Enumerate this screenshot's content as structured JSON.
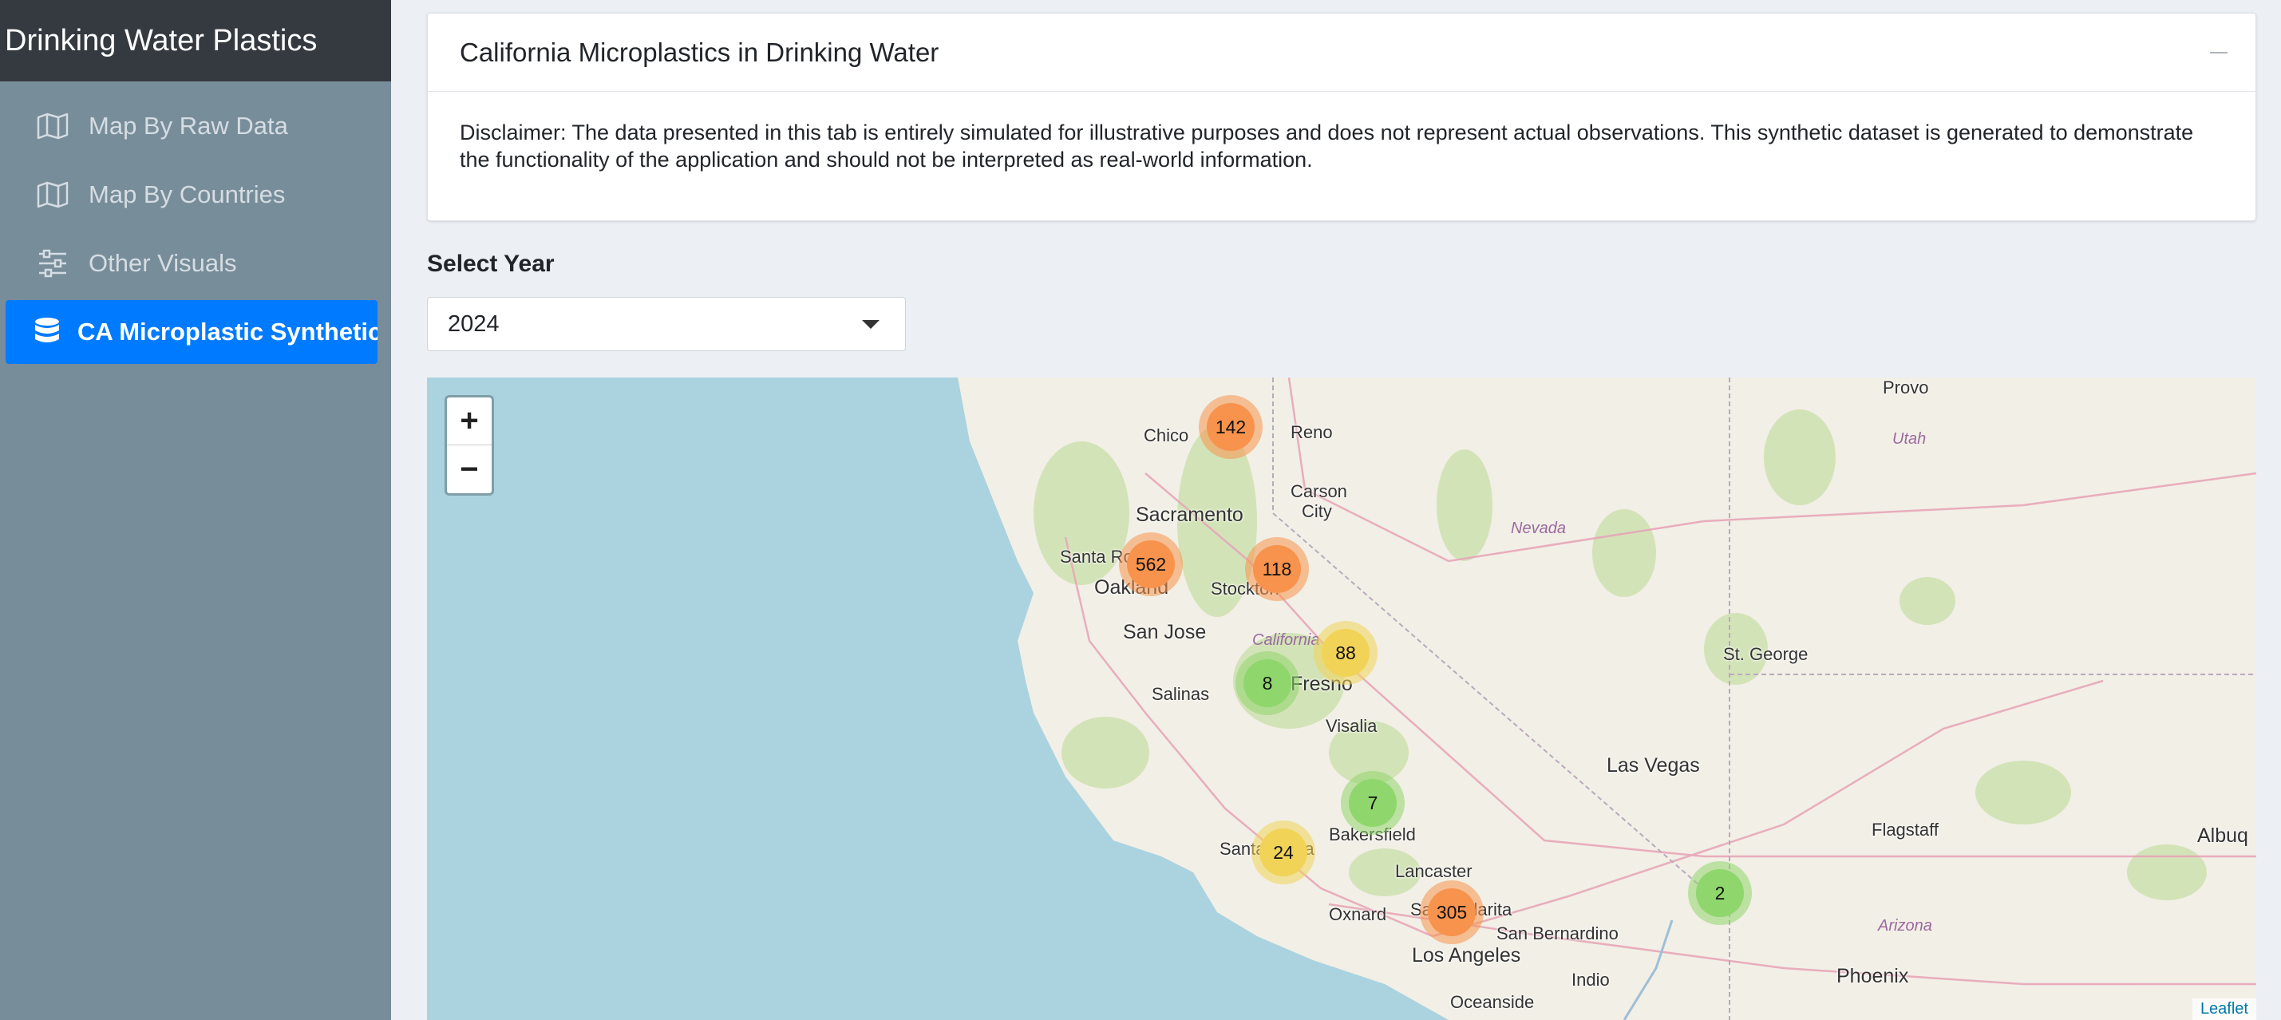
{
  "app": {
    "title": "Drinking Water Plastics"
  },
  "sidebar": {
    "items": [
      {
        "label": "Map By Raw Data",
        "icon": "map-icon",
        "active": false
      },
      {
        "label": "Map By Countries",
        "icon": "map-icon",
        "active": false
      },
      {
        "label": "Other Visuals",
        "icon": "sliders-icon",
        "active": false
      },
      {
        "label": "CA Microplastic Synthetic Data",
        "icon": "database-icon",
        "active": true
      }
    ]
  },
  "card": {
    "title": "California Microplastics in Drinking Water",
    "disclaimer": "Disclaimer: The data presented in this tab is entirely simulated for illustrative purposes and does not represent actual observations. This synthetic dataset is generated to demonstrate the functionality of the application and should not be interpreted as real-world information."
  },
  "year_select": {
    "label": "Select Year",
    "value": "2024"
  },
  "map": {
    "zoom_in": "+",
    "zoom_out": "−",
    "attribution": "Leaflet",
    "cities": {
      "chico": "Chico",
      "reno": "Reno",
      "carson": "Carson",
      "city": "City",
      "sacramento": "Sacramento",
      "santa_rosa": "Santa Rosa",
      "oakland": "Oakland",
      "stockton": "Stockton",
      "san_jose": "San Jose",
      "california": "California",
      "fresno": "Fresno",
      "salinas": "Salinas",
      "visalia": "Visalia",
      "bakersfield": "Bakersfield",
      "santa_maria": "Santa Maria",
      "lancaster": "Lancaster",
      "oxnard": "Oxnard",
      "santa_clarita": "Santa Clarita",
      "los_angeles": "Los Angeles",
      "san_bernardino": "San Bernardino",
      "indio": "Indio",
      "oceanside": "Oceanside",
      "nevada": "Nevada",
      "las_vegas": "Las Vegas",
      "st_george": "St. George",
      "provo": "Provo",
      "utah": "Utah",
      "flagstaff": "Flagstaff",
      "arizona": "Arizona",
      "phoenix": "Phoenix",
      "albuq": "Albuq"
    },
    "clusters": [
      {
        "count": "142",
        "level": "high"
      },
      {
        "count": "562",
        "level": "high"
      },
      {
        "count": "118",
        "level": "high"
      },
      {
        "count": "88",
        "level": "mid"
      },
      {
        "count": "8",
        "level": "low"
      },
      {
        "count": "7",
        "level": "low"
      },
      {
        "count": "24",
        "level": "mid"
      },
      {
        "count": "305",
        "level": "high"
      },
      {
        "count": "2",
        "level": "low"
      }
    ],
    "colors": {
      "high": "#f7934d",
      "mid": "#f1d357",
      "low": "#8fd66c",
      "water": "#aad3df",
      "land": "#f2efe6"
    }
  }
}
